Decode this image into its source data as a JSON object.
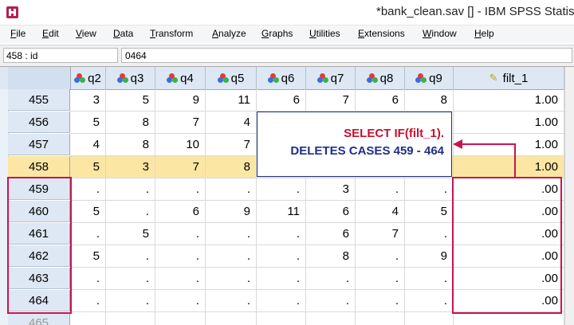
{
  "window": {
    "title": "*bank_clean.sav [] - IBM SPSS Statistics"
  },
  "menu": [
    {
      "label": "File",
      "u": "F",
      "rest": "ile"
    },
    {
      "label": "Edit",
      "u": "E",
      "rest": "dit"
    },
    {
      "label": "View",
      "u": "V",
      "rest": "iew"
    },
    {
      "label": "Data",
      "u": "D",
      "rest": "ata"
    },
    {
      "label": "Transform",
      "u": "T",
      "rest": "ransform"
    },
    {
      "label": "Analyze",
      "u": "A",
      "rest": "nalyze"
    },
    {
      "label": "Graphs",
      "u": "G",
      "rest": "raphs"
    },
    {
      "label": "Utilities",
      "u": "U",
      "rest": "tilities"
    },
    {
      "label": "Extensions",
      "u": "E",
      "rest": "xtensions"
    },
    {
      "label": "Window",
      "u": "W",
      "rest": "indow"
    },
    {
      "label": "Help",
      "u": "H",
      "rest": "elp"
    }
  ],
  "editor": {
    "cell_ref": "458 : id",
    "cell_value": "0464"
  },
  "columns": [
    "q2",
    "q3",
    "q4",
    "q5",
    "q6",
    "q7",
    "q8",
    "q9",
    "filt_1"
  ],
  "rows": [
    {
      "case": "455",
      "values": [
        "3",
        "5",
        "9",
        "11",
        "6",
        "7",
        "6",
        "8",
        "1.00"
      ]
    },
    {
      "case": "456",
      "values": [
        "5",
        "8",
        "7",
        "4",
        "",
        "",
        "",
        "",
        "1.00"
      ]
    },
    {
      "case": "457",
      "values": [
        "4",
        "8",
        "10",
        "7",
        "",
        "",
        "",
        "",
        "1.00"
      ]
    },
    {
      "case": "458",
      "values": [
        "5",
        "3",
        "7",
        "8",
        "",
        "",
        "",
        "",
        "1.00"
      ],
      "selected": true
    },
    {
      "case": "459",
      "values": [
        ".",
        ".",
        ".",
        ".",
        ".",
        "3",
        ".",
        ".",
        ".00"
      ]
    },
    {
      "case": "460",
      "values": [
        "5",
        ".",
        "6",
        "9",
        "11",
        "6",
        "4",
        "5",
        ".00"
      ]
    },
    {
      "case": "461",
      "values": [
        ".",
        "5",
        ".",
        ".",
        ".",
        "6",
        "7",
        ".",
        ".00"
      ]
    },
    {
      "case": "462",
      "values": [
        "5",
        ".",
        ".",
        ".",
        ".",
        "8",
        ".",
        "9",
        ".00"
      ]
    },
    {
      "case": "463",
      "values": [
        ".",
        ".",
        ".",
        ".",
        ".",
        ".",
        ".",
        ".",
        ".00"
      ]
    },
    {
      "case": "464",
      "values": [
        ".",
        ".",
        ".",
        ".",
        ".",
        ".",
        ".",
        ".",
        ".00"
      ]
    },
    {
      "case": "465",
      "values": [
        "",
        "",
        "",
        "",
        "",
        "",
        "",
        "",
        ""
      ],
      "partial": true
    }
  ],
  "annotation": {
    "line1": "SELECT IF(filt_1).",
    "line2": "DELETES CASES 459 - 464",
    "highlight_color": "#c8144e",
    "callout_color": "#1f2f86"
  },
  "colors": {
    "header_bg": "#dde8f4",
    "selected_row": "#fbe6a4"
  }
}
